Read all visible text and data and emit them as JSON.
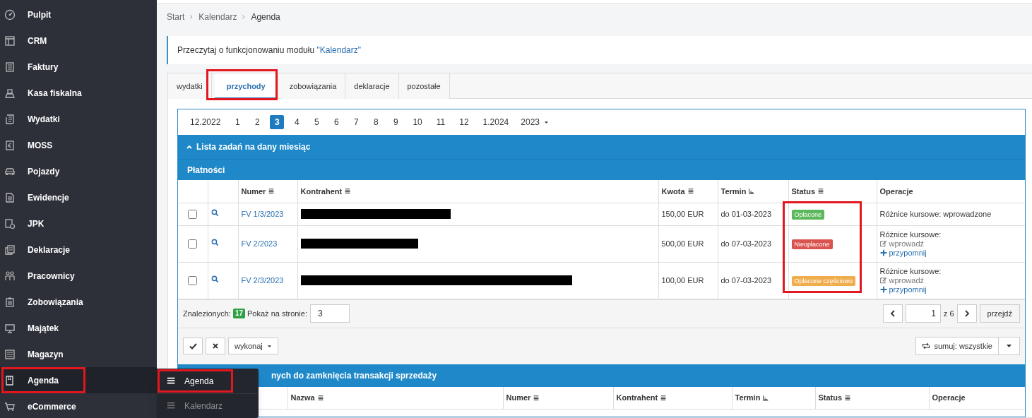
{
  "sidebar": {
    "items": [
      {
        "label": "Pulpit",
        "selected": false,
        "highlighted": false
      },
      {
        "label": "CRM",
        "selected": false,
        "highlighted": false
      },
      {
        "label": "Faktury",
        "selected": false,
        "highlighted": false
      },
      {
        "label": "Kasa fiskalna",
        "selected": false,
        "highlighted": false
      },
      {
        "label": "Wydatki",
        "selected": false,
        "highlighted": false
      },
      {
        "label": "MOSS",
        "selected": false,
        "highlighted": false
      },
      {
        "label": "Pojazdy",
        "selected": false,
        "highlighted": false
      },
      {
        "label": "Ewidencje",
        "selected": false,
        "highlighted": false
      },
      {
        "label": "JPK",
        "selected": false,
        "highlighted": false
      },
      {
        "label": "Deklaracje",
        "selected": false,
        "highlighted": false
      },
      {
        "label": "Pracownicy",
        "selected": false,
        "highlighted": false
      },
      {
        "label": "Zobowiązania",
        "selected": false,
        "highlighted": false
      },
      {
        "label": "Majątek",
        "selected": false,
        "highlighted": false
      },
      {
        "label": "Magazyn",
        "selected": false,
        "highlighted": false
      },
      {
        "label": "Agenda",
        "selected": true,
        "highlighted": true
      },
      {
        "label": "eCommerce",
        "selected": false,
        "highlighted": false
      }
    ]
  },
  "submenu": {
    "items": [
      {
        "label": "Agenda",
        "selected": true,
        "highlighted": true
      },
      {
        "label": "Kalendarz",
        "selected": false,
        "highlighted": false
      }
    ]
  },
  "breadcrumb": [
    "Start",
    "Kalendarz",
    "Agenda"
  ],
  "info": {
    "text": "Przeczytaj o funkcjonowaniu modułu",
    "link": "\"Kalendarz\""
  },
  "tabs": [
    {
      "label": "wydatki",
      "selected": false,
      "highlighted": false
    },
    {
      "label": "przychody",
      "selected": true,
      "highlighted": true
    },
    {
      "label": "zobowiązania",
      "selected": false,
      "highlighted": false
    },
    {
      "label": "deklaracje",
      "selected": false,
      "highlighted": false
    },
    {
      "label": "pozostałe",
      "selected": false,
      "highlighted": false
    }
  ],
  "months": [
    {
      "label": "12.2022",
      "selected": false
    },
    {
      "label": "1",
      "selected": false
    },
    {
      "label": "2",
      "selected": false
    },
    {
      "label": "3",
      "selected": true
    },
    {
      "label": "4",
      "selected": false
    },
    {
      "label": "5",
      "selected": false
    },
    {
      "label": "6",
      "selected": false
    },
    {
      "label": "7",
      "selected": false
    },
    {
      "label": "8",
      "selected": false
    },
    {
      "label": "9",
      "selected": false
    },
    {
      "label": "10",
      "selected": false
    },
    {
      "label": "11",
      "selected": false
    },
    {
      "label": "12",
      "selected": false
    },
    {
      "label": "1.2024",
      "selected": false
    }
  ],
  "year": "2023",
  "section_title": "Lista zadań na dany miesiąc",
  "payments": {
    "title": "Płatności",
    "status_highlighted": true,
    "columns": [
      {
        "label": "Numer",
        "kind": "list"
      },
      {
        "label": "Kontrahent",
        "kind": "list"
      },
      {
        "label": "Kwota",
        "kind": "list"
      },
      {
        "label": "Termin",
        "kind": "asc"
      },
      {
        "label": "Status",
        "kind": "list"
      },
      {
        "label": "Operacje",
        "kind": "plain"
      }
    ],
    "rows": [
      {
        "checked": false,
        "number": "FV 1/3/2023",
        "contractor_redacted": true,
        "amount": "150,00 EUR",
        "due": "do 01-03-2023",
        "status": {
          "label": "Opłacone",
          "color": "#5cb85c"
        },
        "operations": [
          {
            "kind": "text",
            "text": "Różnice kursowe: wprowadzone"
          }
        ]
      },
      {
        "checked": false,
        "number": "FV 2/2023",
        "contractor_redacted": true,
        "amount": "500,00 EUR",
        "due": "do 07-03-2023",
        "status": {
          "label": "Nieopłacone",
          "color": "#d9534f"
        },
        "operations": [
          {
            "kind": "text",
            "text": "Różnice kursowe:"
          },
          {
            "kind": "edit",
            "text": "wprowadź"
          },
          {
            "kind": "add",
            "text": "przypomnij"
          }
        ]
      },
      {
        "checked": false,
        "number": "FV 2/3/2023",
        "contractor_redacted": true,
        "amount": "100,00 EUR",
        "due": "do 07-03-2023",
        "status": {
          "label": "Opłacone częściowo",
          "color": "#f0ad4e"
        },
        "operations": [
          {
            "kind": "text",
            "text": "Różnice kursowe:"
          },
          {
            "kind": "edit",
            "text": "wprowadź"
          },
          {
            "kind": "add",
            "text": "przypomnij"
          }
        ]
      }
    ],
    "found_label": "Znalezionych:",
    "found_count": "17",
    "per_page_label": "Pokaż na stronie:",
    "per_page": "3",
    "page": "1",
    "page_of": "z 6",
    "go_label": "przejdź",
    "action_label": "wykonaj",
    "sum_label": "sumuj: wszystkie"
  },
  "closing": {
    "title": "nych do zamknięcia transakcji sprzedaży",
    "columns": [
      {
        "label": "Nazwa",
        "kind": "list"
      },
      {
        "label": "Numer",
        "kind": "list"
      },
      {
        "label": "Kontrahent",
        "kind": "list"
      },
      {
        "label": "Termin",
        "kind": "asc"
      },
      {
        "label": "Status",
        "kind": "list"
      },
      {
        "label": "Operacje",
        "kind": "plain"
      }
    ]
  }
}
